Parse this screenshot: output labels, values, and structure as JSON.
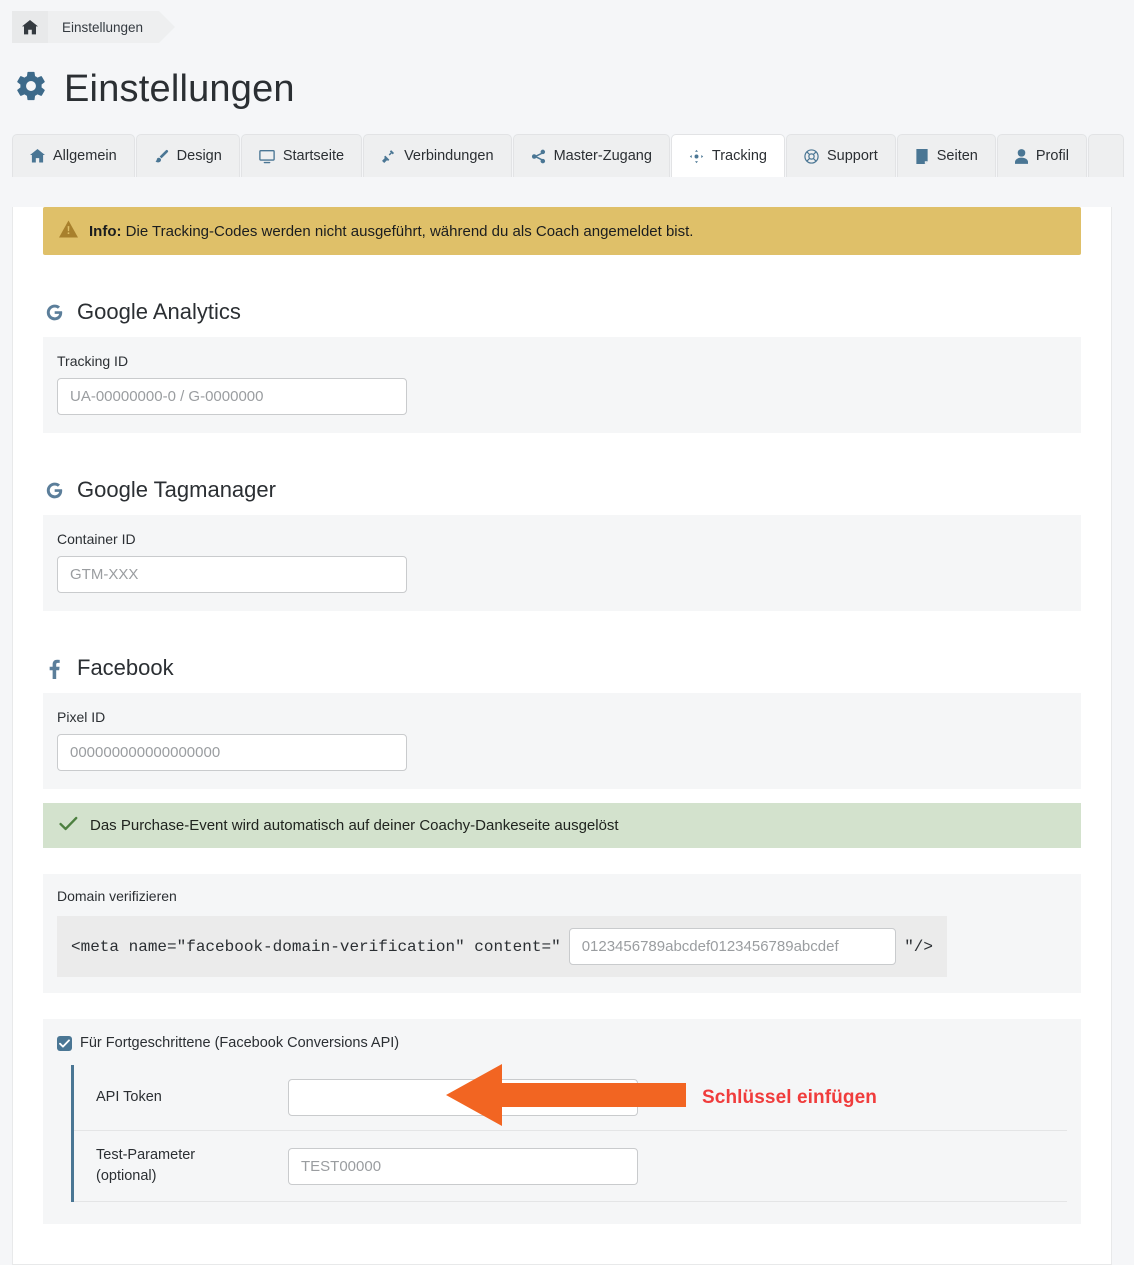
{
  "breadcrumb": {
    "home_icon": "home-icon",
    "page": "Einstellungen"
  },
  "header": {
    "icon": "gear-icon",
    "title": "Einstellungen"
  },
  "tabs": [
    {
      "label": "Allgemein",
      "icon": "home-icon",
      "active": false
    },
    {
      "label": "Design",
      "icon": "brush-icon",
      "active": false
    },
    {
      "label": "Startseite",
      "icon": "monitor-icon",
      "active": false
    },
    {
      "label": "Verbindungen",
      "icon": "plug-icon",
      "active": false
    },
    {
      "label": "Master-Zugang",
      "icon": "share-icon",
      "active": false
    },
    {
      "label": "Tracking",
      "icon": "crosshair-icon",
      "active": true
    },
    {
      "label": "Support",
      "icon": "lifebuoy-icon",
      "active": false
    },
    {
      "label": "Seiten",
      "icon": "page-icon",
      "active": false
    },
    {
      "label": "Profil",
      "icon": "user-icon",
      "active": false
    }
  ],
  "banner": {
    "icon": "warning-triangle-icon",
    "strong": "Info:",
    "text": " Die Tracking-Codes werden nicht ausgeführt, während du als Coach angemeldet bist.",
    "bg_color": "#dfc069"
  },
  "sections": {
    "analytics": {
      "icon": "google-g-icon",
      "title": "Google Analytics",
      "field_label": "Tracking ID",
      "field_value": "",
      "field_placeholder": "UA-00000000-0 / G-0000000"
    },
    "tagmanager": {
      "icon": "google-g-icon",
      "title": "Google Tagmanager",
      "field_label": "Container ID",
      "field_value": "",
      "field_placeholder": "GTM-XXX"
    },
    "facebook": {
      "icon": "facebook-f-icon",
      "title": "Facebook",
      "pixel_label": "Pixel ID",
      "pixel_value": "",
      "pixel_placeholder": "000000000000000000",
      "success_icon": "check-icon",
      "success_text": "Das Purchase-Event wird automatisch auf deiner Coachy-Dankeseite ausgelöst",
      "success_bg_color": "#d3e2cd",
      "domain": {
        "label": "Domain verifizieren",
        "code_prefix": "<meta name=\"facebook-domain-verification\" content=\"",
        "code_suffix": "\"/>",
        "value": "",
        "placeholder": "0123456789abcdef0123456789abcdef"
      },
      "advanced": {
        "checkbox_checked": true,
        "checkbox_label": "Für Fortgeschrittene (Facebook Conversions API)",
        "rows": [
          {
            "label": "API Token",
            "value": "",
            "placeholder": ""
          },
          {
            "label": "Test-Parameter\n(optional)",
            "value": "",
            "placeholder": "TEST00000"
          }
        ]
      }
    }
  },
  "annotation": {
    "text": "Schlüssel einfügen",
    "arrow": "left-arrow-icon",
    "arrow_color": "#f26522",
    "text_color": "#f03c3c"
  }
}
